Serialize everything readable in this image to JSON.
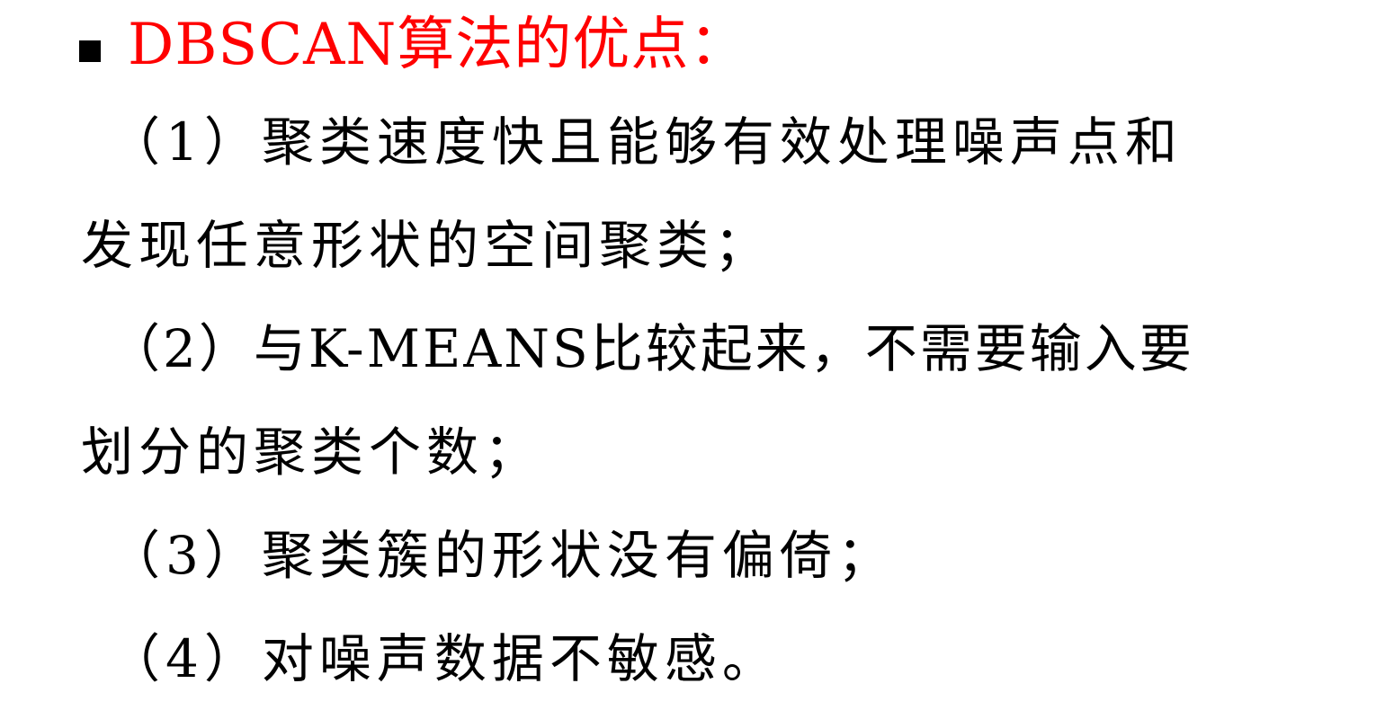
{
  "heading": {
    "text": "DBSCAN算法的优点：",
    "color": "#ff0000",
    "bullet_icon": "black-square-icon"
  },
  "body_lines": [
    "（1）聚类速度快且能够有效处理噪声点和",
    "发现任意形状的空间聚类；",
    "（2）与K-MEANS比较起来，不需要输入要",
    "划分的聚类个数；",
    "（3）聚类簇的形状没有偏倚；",
    "（4）对噪声数据不敏感。"
  ],
  "colors": {
    "text": "#000000",
    "background": "#ffffff"
  }
}
